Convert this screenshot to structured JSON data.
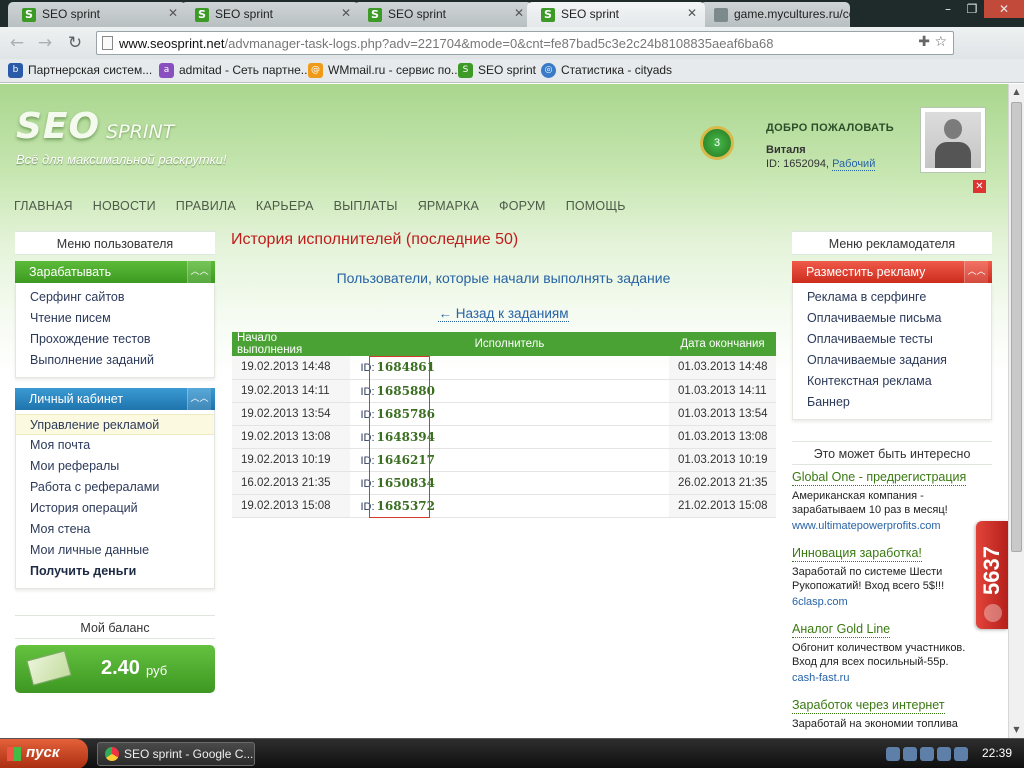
{
  "browser": {
    "tabs": [
      {
        "title": "SEO sprint",
        "icon": "S"
      },
      {
        "title": "SEO sprint",
        "icon": "S"
      },
      {
        "title": "SEO sprint",
        "icon": "S"
      },
      {
        "title": "SEO sprint",
        "icon": "S"
      },
      {
        "title": "game.mycultures.ru/co/l",
        "icon": ""
      }
    ],
    "url_host": "www.seosprint.net",
    "url_rest": "/advmanager-task-logs.php?adv=221704&mode=0&cnt=fe87bad5c3e2c24b8108835aeaf6ba68",
    "bookmarks": [
      "Партнерская систем...",
      "admitad - Сеть партне...",
      "WMmail.ru - сервис по...",
      "SEO sprint",
      "Статистика - cityads"
    ]
  },
  "site": {
    "logo_seo": "SEO",
    "logo_sprint": "SPRINT",
    "tagline": "Всё для максимальной раскрутки!",
    "level_badge": "3",
    "welcome_title": "ДОБРО ПОЖАЛОВАТЬ",
    "user_name": "Виталя",
    "user_id": "ID: 1652094,",
    "user_status": "Рабочий",
    "nav": [
      "ГЛАВНАЯ",
      "НОВОСТИ",
      "ПРАВИЛА",
      "КАРЬЕРА",
      "ВЫПЛАТЫ",
      "ЯРМАРКА",
      "ФОРУМ",
      "ПОМОЩЬ"
    ]
  },
  "left": {
    "title": "Меню пользователя",
    "earn_header": "Зарабатывать",
    "earn_items": [
      "Серфинг сайтов",
      "Чтение писем",
      "Прохождение тестов",
      "Выполнение заданий"
    ],
    "cabinet_header": "Личный кабинет",
    "cabinet_items": [
      "Управление рекламой",
      "Моя почта",
      "Мои рефералы",
      "Работа с рефералами",
      "История операций",
      "Моя стена",
      "Мои личные данные",
      "Получить деньги"
    ],
    "balance_title": "Мой баланс",
    "balance_amount": "2.40",
    "balance_currency": "руб"
  },
  "main": {
    "title": "История исполнителей (последние 50)",
    "subtitle": "Пользователи, которые начали выполнять задание",
    "back_link": "← Назад к заданиям",
    "columns": [
      "Начало выполнения",
      "Исполнитель",
      "Дата окончания"
    ],
    "rows": [
      {
        "start": "19.02.2013 14:48",
        "id_label": "ID:",
        "id": "1684861",
        "end": "01.03.2013 14:48"
      },
      {
        "start": "19.02.2013 14:11",
        "id_label": "ID:",
        "id": "1685880",
        "end": "01.03.2013 14:11"
      },
      {
        "start": "19.02.2013 13:54",
        "id_label": "ID:",
        "id": "1685786",
        "end": "01.03.2013 13:54"
      },
      {
        "start": "19.02.2013 13:08",
        "id_label": "ID:",
        "id": "1648394",
        "end": "01.03.2013 13:08"
      },
      {
        "start": "19.02.2013 10:19",
        "id_label": "ID:",
        "id": "1646217",
        "end": "01.03.2013 10:19"
      },
      {
        "start": "16.02.2013 21:35",
        "id_label": "ID:",
        "id": "1650834",
        "end": "26.02.2013 21:35"
      },
      {
        "start": "19.02.2013 15:08",
        "id_label": "ID:",
        "id": "1685372",
        "end": "21.02.2013 15:08"
      }
    ]
  },
  "right": {
    "title": "Меню рекламодателя",
    "place_header": "Разместить рекламу",
    "place_items": [
      "Реклама в серфинге",
      "Оплачиваемые письма",
      "Оплачиваемые тесты",
      "Оплачиваемые задания",
      "Контекстная реклама",
      "Баннер"
    ],
    "interest_title": "Это может быть интересно",
    "ads": [
      {
        "title": "Global One - предрегистрация",
        "text": "Американская компания - зарабатываем 10 раз в месяц!",
        "url": "www.ultimatepowerprofits.com"
      },
      {
        "title": "Инновация заработка!",
        "text": "Заработай по системе Шести Рукопожатий! Вход всего 5$!!!",
        "url": "6clasp.com"
      },
      {
        "title": "Аналог Gold Line",
        "text": "Обгонит количеством участников. Вход для всех посильный-55р.",
        "url": "cash-fast.ru"
      },
      {
        "title": "Заработок через интернет",
        "text": "Заработай на экономии топлива",
        "url": ""
      }
    ],
    "counter": "5637"
  },
  "taskbar": {
    "start": "пуск",
    "task": "SEO sprint - Google C...",
    "clock": "22:39"
  },
  "icons": {
    "tab_favicon": "seosprint-s-icon",
    "back": "back-arrow-icon",
    "forward": "forward-arrow-icon",
    "reload": "reload-icon",
    "star": "star-icon",
    "wrench": "wrench-icon",
    "chevron": "double-chevron-icon",
    "logout": "close-icon"
  },
  "colors": {
    "accent_green": "#49a233",
    "accent_blue": "#1f74ad",
    "accent_red": "#cc2c1c",
    "title_red": "#c01c1c",
    "link_blue": "#2763a6"
  }
}
